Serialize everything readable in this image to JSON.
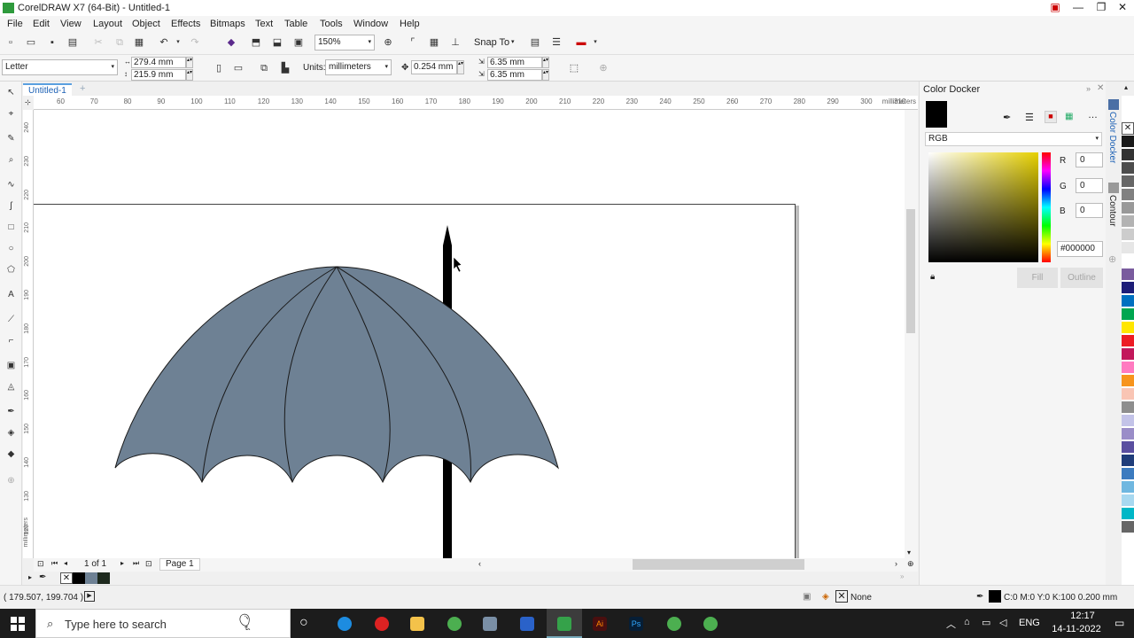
{
  "window": {
    "title": "CorelDRAW X7 (64-Bit) - Untitled-1"
  },
  "menu": [
    "File",
    "Edit",
    "View",
    "Layout",
    "Object",
    "Effects",
    "Bitmaps",
    "Text",
    "Table",
    "Tools",
    "Window",
    "Help"
  ],
  "toolbar": {
    "zoom": "150%",
    "snap_to": "Snap To"
  },
  "propbar": {
    "page_size": "Letter",
    "width": "279.4 mm",
    "height": "215.9 mm",
    "units_label": "Units:",
    "units": "millimeters",
    "nudge": "0.254 mm",
    "dup_x": "6.35 mm",
    "dup_y": "6.35 mm"
  },
  "document": {
    "tab": "Untitled-1"
  },
  "ruler": {
    "h_ticks": [
      "60",
      "70",
      "80",
      "90",
      "100",
      "110",
      "120",
      "130",
      "140",
      "150",
      "160",
      "170",
      "180",
      "190",
      "200",
      "210",
      "220",
      "230",
      "240",
      "250",
      "260",
      "270",
      "280",
      "290",
      "300",
      "310"
    ],
    "h_unit": "millimeters",
    "v_ticks": [
      "240",
      "230",
      "220",
      "210",
      "200",
      "190",
      "180",
      "170",
      "160",
      "150",
      "140",
      "130",
      "120"
    ],
    "v_unit": "millimeters"
  },
  "page_nav": {
    "count": "1 of 1",
    "page": "Page 1"
  },
  "docker": {
    "title": "Color Docker",
    "mode": "RGB",
    "r_label": "R",
    "r": "0",
    "g_label": "G",
    "g": "0",
    "b_label": "B",
    "b": "0",
    "hex": "#000000",
    "fill": "Fill",
    "outline": "Outline",
    "tab1": "Color Docker",
    "tab2": "Contour"
  },
  "palette": [
    "#1a1a1a",
    "#333333",
    "#4d4d4d",
    "#666666",
    "#808080",
    "#999999",
    "#b3b3b3",
    "#cccccc",
    "#e6e6e6",
    "#ffffff",
    "#7a5c9e",
    "#1e1e78",
    "#0070c0",
    "#00a650",
    "#ffe600",
    "#ed1c24",
    "#c2185b",
    "#ff7ac0",
    "#f7941d",
    "#f9c5b4",
    "#8e8e8e",
    "#c3c3e8",
    "#9a8dc8",
    "#5a4fa0",
    "#1f3d7a",
    "#3c7bbf",
    "#6fb7e0",
    "#a7d8f0",
    "#00b7c7",
    "#666666"
  ],
  "statusbar": {
    "coords": "( 179.507, 199.704 )",
    "fill": "None",
    "outline": "C:0 M:0 Y:0 K:100  0.200 mm"
  },
  "taskbar": {
    "search": "Type here to search",
    "lang": "ENG",
    "time": "12:17",
    "date": "14-11-2022"
  },
  "colors": {
    "umbrella_fill": "#6e8194",
    "umbrella_stroke": "#1a1a1a",
    "handle": "#000000",
    "accent": "#1a5fb4"
  }
}
